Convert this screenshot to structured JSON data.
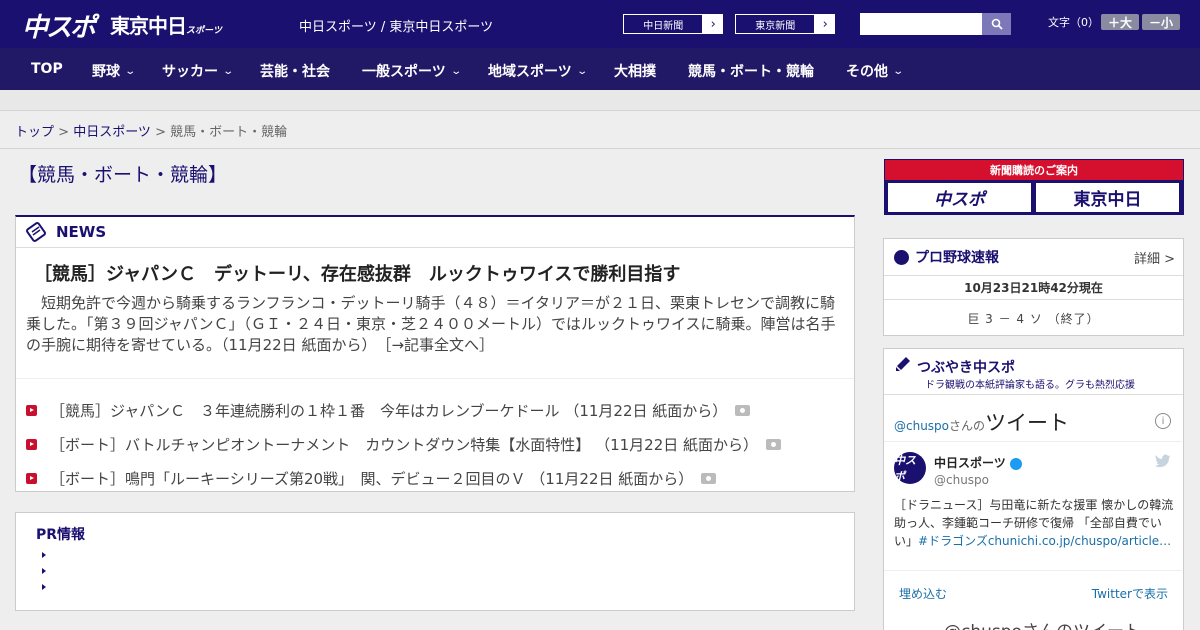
{
  "header": {
    "logo_chuspo": "中スポ",
    "logo_tokyo": "東京中日",
    "logo_tokyo_small": "スポーツ",
    "site_names": "中日スポーツ / 東京中日スポーツ",
    "btn_chunichi": "中日新聞",
    "btn_tokyo": "東京新聞",
    "search_placeholder": "",
    "fontsize_label": "文字（0）",
    "fs_large": "＋大",
    "fs_small": "－小"
  },
  "nav": {
    "items": [
      {
        "label": "TOP"
      },
      {
        "label": "野球"
      },
      {
        "label": "サッカー"
      },
      {
        "label": "芸能・社会"
      },
      {
        "label": "一般スポーツ"
      },
      {
        "label": "地域スポーツ"
      },
      {
        "label": "大相撲"
      },
      {
        "label": "競馬・ボート・競輪"
      },
      {
        "label": "その他"
      }
    ]
  },
  "breadcrumb": {
    "top": "トップ",
    "sep": " > ",
    "chuspo": "中日スポーツ",
    "current": "競馬・ボート・競輪"
  },
  "page_title": "【競馬・ボート・競輪】",
  "news": {
    "header": "NEWS",
    "lead_title": "［競馬］ジャパンＣ　デットーリ、存在感抜群　ルックトゥワイスで勝利目指す",
    "lead_body": "短期免許で今週から騎乗するランフランコ・デットーリ騎手（４８）＝イタリア＝が２１日、栗東トレセンで調教に騎乗した。「第３９回ジャパンＣ」（ＧＩ・２４日・東京・芝２４００メートル）ではルックトゥワイスに騎乗。陣営は名手の手腕に期待を寄せている。（11月22日 紙面から）　［→記事全文へ］",
    "items": [
      {
        "text": "［競馬］ジャパンＣ　３年連続勝利の１枠１番　今年はカレンブーケドール （11月22日 紙面から）"
      },
      {
        "text": "［ボート］バトルチャンピオントーナメント　カウントダウン特集【水面特性】 （11月22日 紙面から）"
      },
      {
        "text": "［ボート］鳴門「ルーキーシリーズ第20戦」　関、デビュー２回目のＶ （11月22日 紙面から）"
      }
    ]
  },
  "pr": {
    "title": "PR情報"
  },
  "sidebar": {
    "subscribe_top": "新聞購読のご案内",
    "subscribe_chuspo": "中スポ",
    "subscribe_tokyo": "東京中日",
    "baseball_title": "プロ野球速報",
    "baseball_more": "詳細 >",
    "baseball_time": "10月23日21時42分現在",
    "baseball_score": "巨 3 － 4 ソ （終了）",
    "tw_title": "つぶやき中スポ",
    "tw_sub": "ドラ観戦の本紙評論家も語る。グラも熱烈応援",
    "tw_at": "@chuspo",
    "tw_san": "さんの",
    "tw_tweet": "ツイート",
    "tw_name": "中日スポーツ",
    "tw_handle": "@chuspo",
    "tw_avatar": "中スポ",
    "tw_text": "［ドラニュース］与田竜に新たな援軍 懐かしの韓流助っ人、李鍾範コーチ研修で復帰 「全部自費でいい」",
    "tw_hashtag": "#ドラゴンズchunichi.co.jp/chuspo/article…",
    "tw_embed": "埋め込む",
    "tw_view": "Twitterで表示",
    "tw_more": "@chuspoさんのツイート"
  }
}
